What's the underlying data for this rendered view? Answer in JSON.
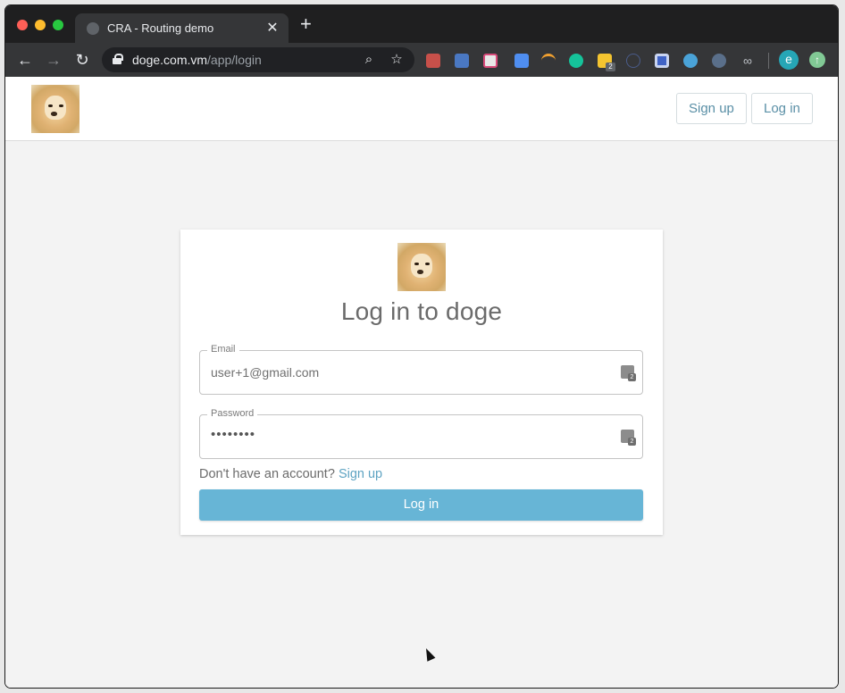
{
  "browser": {
    "tab_title": "CRA - Routing demo",
    "tab_close": "✕",
    "new_tab": "+",
    "url_host": "doge.com.vm",
    "url_path": "/app/login",
    "profile_initial": "e",
    "extensions_badge": "2"
  },
  "header": {
    "signup_label": "Sign up",
    "login_label": "Log in"
  },
  "login_card": {
    "title": "Log in to doge",
    "email_label": "Email",
    "email_value": "user+1@gmail.com",
    "password_label": "Password",
    "password_value": "••••••••",
    "no_account_text": "Don't have an account?",
    "signup_link": "Sign up",
    "submit_label": "Log in"
  },
  "colors": {
    "accent": "#67b5d6",
    "link": "#5ea3c2",
    "header_button_text": "#5a8fa6"
  }
}
